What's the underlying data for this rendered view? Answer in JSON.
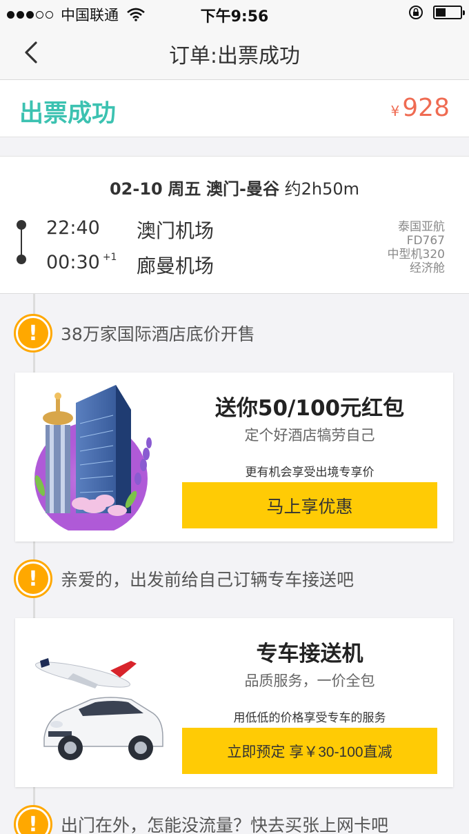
{
  "status_bar": {
    "carrier": "中国联通",
    "time": "下午9:56"
  },
  "nav": {
    "title": "订单:出票成功"
  },
  "order": {
    "status": "出票成功",
    "currency": "¥",
    "price": "928"
  },
  "flight": {
    "date": "02-10",
    "weekday": "周五",
    "route": "澳门-曼谷",
    "duration": "约2h50m",
    "dep_time": "22:40",
    "arr_time": "00:30",
    "arr_day_offset": "+1",
    "dep_airport": "澳门机场",
    "arr_airport": "廊曼机场",
    "airline": "泰国亚航",
    "flight_no": "FD767",
    "aircraft": "中型机320",
    "cabin": "经济舱"
  },
  "tips": [
    {
      "icon": "exclamation-icon",
      "text": "38万家国际酒店底价开售"
    },
    {
      "icon": "exclamation-icon",
      "text": "亲爱的，出发前给自己订辆专车接送吧"
    },
    {
      "icon": "exclamation-icon",
      "text": "出门在外，怎能没流量？快去买张上网卡吧"
    }
  ],
  "promos": [
    {
      "image": "hotel-illustration",
      "title": "送你50/100元红包",
      "subtitle": "定个好酒店犒劳自己",
      "note": "更有机会享受出境专享价",
      "cta": "马上享优惠"
    },
    {
      "image": "car-plane-illustration",
      "title": "专车接送机",
      "subtitle": "品质服务，一价全包",
      "note": "用低低的价格享受专车的服务",
      "cta": "立即预定 享￥30-100直减"
    }
  ],
  "colors": {
    "success": "#3cc2b1",
    "price": "#ef6b52",
    "accent": "#ffcb05",
    "warning": "#ffa800"
  }
}
